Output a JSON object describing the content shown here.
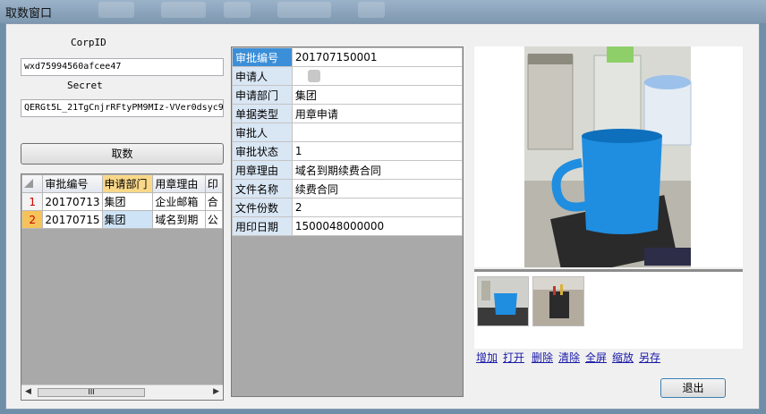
{
  "window": {
    "title": "取数窗口"
  },
  "form": {
    "corpid_label": "CorpID",
    "corpid_value": "wxd75994560afcee47",
    "secret_label": "Secret",
    "secret_value": "QERGt5L_21TgCnjrRFtyPM9MIz-VVer0dsyc9",
    "fetch_label": "取数"
  },
  "list_grid": {
    "columns": [
      "审批编号",
      "申请部门",
      "用章理由",
      "印"
    ],
    "rows": [
      {
        "num": "1",
        "cells": [
          "20170713",
          "集团",
          "企业邮箱",
          "合"
        ]
      },
      {
        "num": "2",
        "cells": [
          "20170715",
          "集团",
          "域名到期",
          "公"
        ]
      }
    ],
    "scroll_thumb": "III"
  },
  "detail": {
    "rows": [
      {
        "key": "审批编号",
        "value": "201707150001"
      },
      {
        "key": "申请人",
        "value": ""
      },
      {
        "key": "申请部门",
        "value": "集团"
      },
      {
        "key": "单据类型",
        "value": "用章申请"
      },
      {
        "key": "审批人",
        "value": ""
      },
      {
        "key": "审批状态",
        "value": "1"
      },
      {
        "key": "用章理由",
        "value": "域名到期续费合同"
      },
      {
        "key": "文件名称",
        "value": "续费合同"
      },
      {
        "key": "文件份数",
        "value": "2"
      },
      {
        "key": "用印日期",
        "value": "1500048000000"
      }
    ]
  },
  "image_actions": {
    "add": "增加",
    "open": "打开",
    "delete": "删除",
    "clear": "清除",
    "fullscreen": "全屏",
    "zoom": "缩放",
    "save_as": "另存"
  },
  "exit_label": "退出",
  "colors": {
    "selected_key": "#3b8fd8",
    "key_bg": "#d9e6f4",
    "mug": "#1f8ee0"
  }
}
